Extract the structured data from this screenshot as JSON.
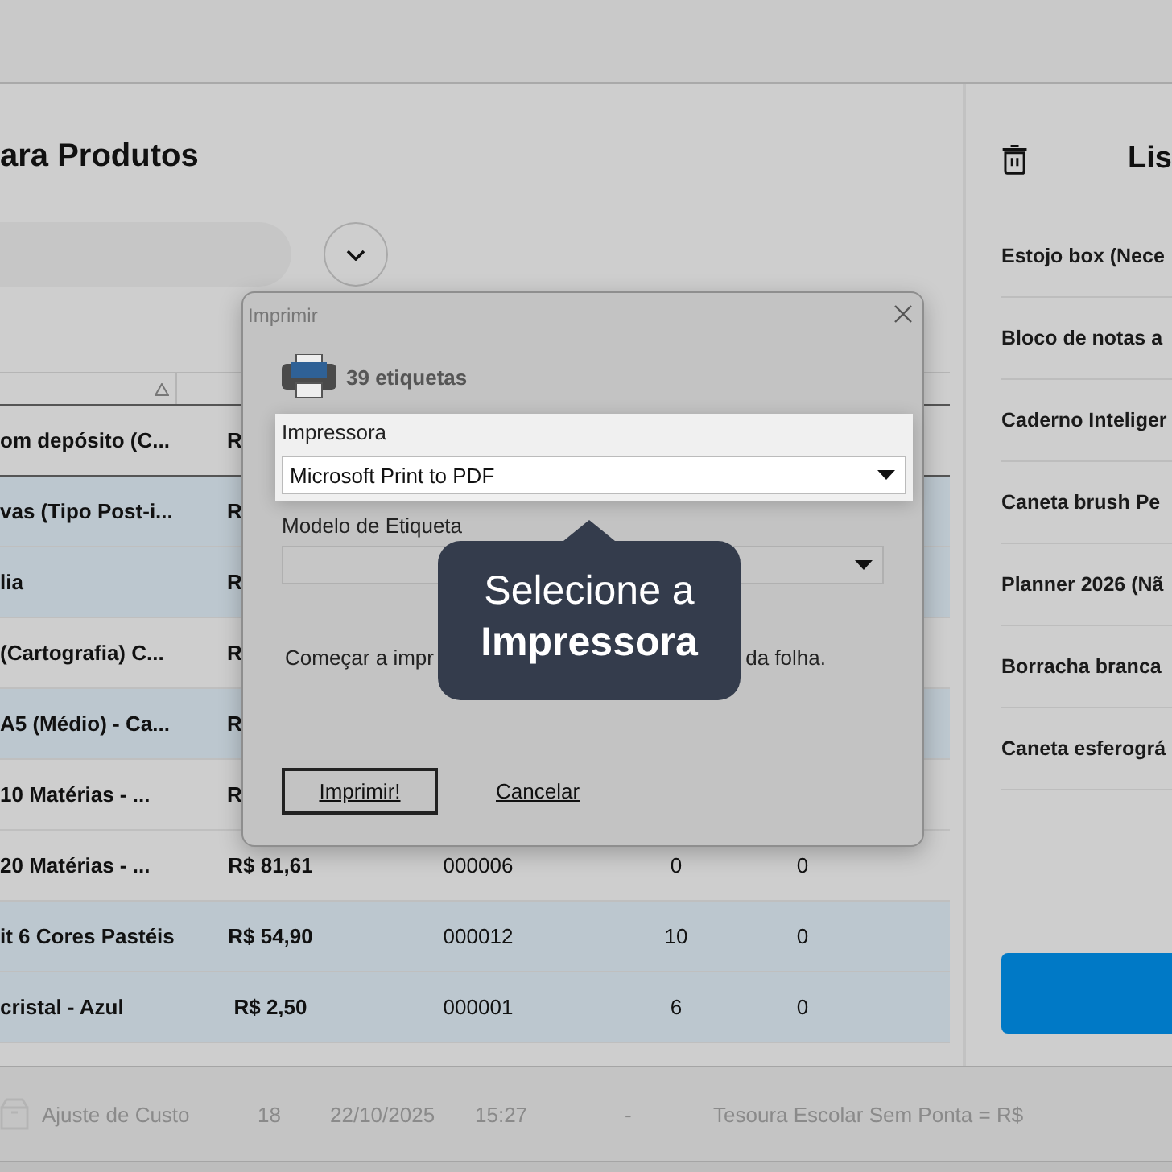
{
  "page": {
    "title": "ara Produtos"
  },
  "table": {
    "rows": [
      {
        "name": "om depósito (C...",
        "price": "R",
        "selected": false
      },
      {
        "name": "vas (Tipo Post-i...",
        "price": "R",
        "selected": true
      },
      {
        "name": "lia",
        "price": "R",
        "selected": true
      },
      {
        "name": "(Cartografia) C...",
        "price": "R",
        "selected": false
      },
      {
        "name": "A5 (Médio) - Ca...",
        "price": "R",
        "selected": true
      },
      {
        "name": "10 Matérias - ...",
        "price": "R",
        "selected": false
      },
      {
        "name": "20 Matérias  - ...",
        "price": "R$ 81,61",
        "code": "000006",
        "qty": "0",
        "column_5": "0",
        "selected": false
      },
      {
        "name": "it 6 Cores Pastéis",
        "price": "R$ 54,90",
        "code": "000012",
        "qty": "10",
        "column_5": "0",
        "selected": true
      },
      {
        "name": "cristal - Azul",
        "price": "R$ 2,50",
        "code": "000001",
        "qty": "6",
        "column_5": "0",
        "selected": true
      }
    ]
  },
  "side_panel": {
    "title": "Lis",
    "items": [
      "Estojo box (Nece",
      "Bloco de notas a",
      "Caderno Inteliger",
      "Caneta brush Pe",
      "Planner 2026 (Nã",
      "Borracha branca",
      "Caneta esferográ"
    ]
  },
  "history_row": {
    "label": "Ajuste de Custo",
    "number": "18",
    "date": "22/10/2025",
    "time": "15:27",
    "dash": "-",
    "description": "Tesoura Escolar Sem Ponta = R$"
  },
  "dialog": {
    "title": "Imprimir",
    "count": "39 etiquetas",
    "printer_label": "Impressora",
    "printer_value": "Microsoft Print to PDF",
    "template_label": "Modelo de Etiqueta",
    "start_text_left": "Começar a impr",
    "start_text_right": "da folha.",
    "buttons": [
      {
        "kind": "primary",
        "label": "Imprimir!"
      },
      {
        "kind": "link",
        "label": "Cancelar"
      }
    ]
  },
  "tooltip": {
    "text": "Selecione a **Impressora**"
  }
}
